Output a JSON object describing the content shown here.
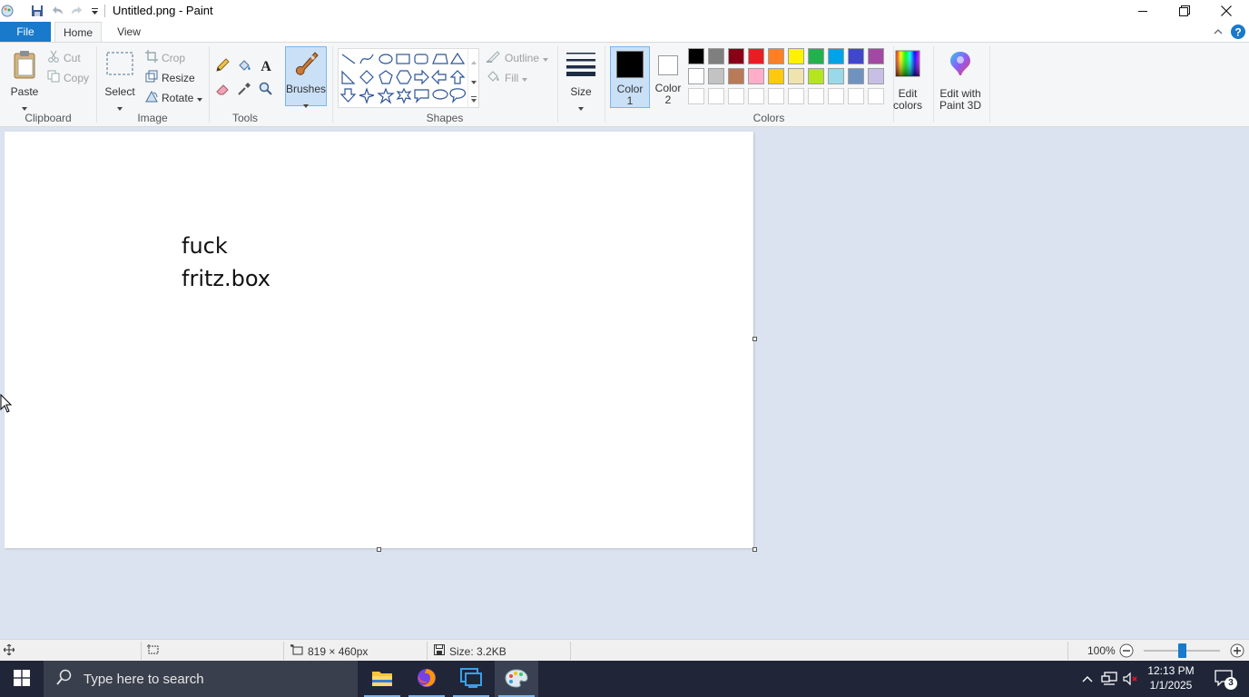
{
  "window": {
    "title": "Untitled.png - Paint",
    "buttons": [
      "minimize",
      "restore",
      "close"
    ]
  },
  "menu": {
    "file_label": "File",
    "tabs": [
      {
        "label": "Home",
        "active": true
      },
      {
        "label": "View",
        "active": false
      }
    ]
  },
  "ribbon": {
    "clipboard": {
      "group_label": "Clipboard",
      "paste_label": "Paste",
      "cut_label": "Cut",
      "copy_label": "Copy"
    },
    "image": {
      "group_label": "Image",
      "select_label": "Select",
      "crop_label": "Crop",
      "resize_label": "Resize",
      "rotate_label": "Rotate"
    },
    "tools": {
      "group_label": "Tools",
      "items": [
        "pencil-icon",
        "fill-icon",
        "text-icon",
        "eraser-icon",
        "color-picker-icon",
        "magnifier-icon"
      ]
    },
    "brushes_label": "Brushes",
    "shapes": {
      "group_label": "Shapes",
      "outline_label": "Outline",
      "fill_label": "Fill"
    },
    "size_label": "Size",
    "color1": {
      "label_line1": "Color",
      "label_line2": "1",
      "value": "#000000"
    },
    "color2": {
      "label_line1": "Color",
      "label_line2": "2",
      "value": "#ffffff"
    },
    "colors": {
      "group_label": "Colors",
      "row1": [
        "#000000",
        "#7f7f7f",
        "#880015",
        "#ed1c24",
        "#ff7f27",
        "#fff200",
        "#22b14c",
        "#00a2e8",
        "#3f48cc",
        "#a349a4"
      ],
      "row2": [
        "#ffffff",
        "#c3c3c3",
        "#b97a57",
        "#ffaec9",
        "#ffc90e",
        "#efe4b0",
        "#b5e61d",
        "#99d9ea",
        "#7092be",
        "#c8bfe7"
      ],
      "row3": [
        "#ffffff",
        "#ffffff",
        "#ffffff",
        "#ffffff",
        "#ffffff",
        "#ffffff",
        "#ffffff",
        "#ffffff",
        "#ffffff",
        "#ffffff"
      ]
    },
    "edit_colors": {
      "line1": "Edit",
      "line2": "colors"
    },
    "paint3d": {
      "line1": "Edit with",
      "line2": "Paint 3D"
    }
  },
  "canvas": {
    "lines": [
      "fuck",
      "fritz.box"
    ]
  },
  "status": {
    "dimensions": "819 × 460px",
    "size": "Size: 3.2KB",
    "zoom": "100%",
    "zoom_level": 1.0
  },
  "taskbar": {
    "search_placeholder": "Type here to search",
    "time": "12:13 PM",
    "date": "1/1/2025",
    "notification_count": "3"
  }
}
